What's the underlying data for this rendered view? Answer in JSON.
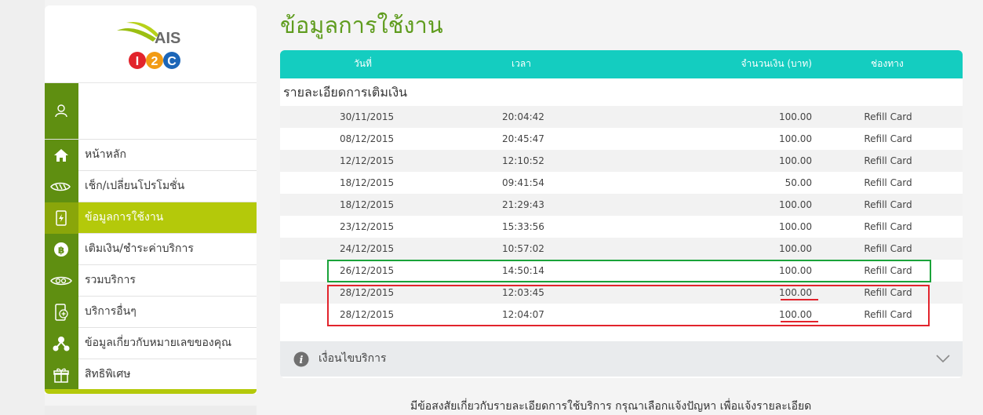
{
  "brand": {
    "logo_text": "AIS",
    "logo_sub": [
      "I",
      "2",
      "C"
    ],
    "colors": {
      "ais_green": "#9bbf12",
      "i_red": "#e2242c",
      "two_orange": "#f29b13",
      "c_blue": "#1c66b8"
    }
  },
  "sidebar": {
    "profile_icon": "user-icon",
    "items": [
      {
        "label": "หน้าหลัก",
        "icon": "home-icon",
        "active": false
      },
      {
        "label": "เช็ก/เปลี่ยนโปรโมชั่น",
        "icon": "promo-icon",
        "active": false
      },
      {
        "label": "ข้อมูลการใช้งาน",
        "icon": "usage-icon",
        "active": true
      },
      {
        "label": "เติมเงิน/ชำระค่าบริการ",
        "icon": "baht-icon",
        "active": false
      },
      {
        "label": "รวมบริการ",
        "icon": "services-icon",
        "active": false
      },
      {
        "label": "บริการอื่นๆ",
        "icon": "phone-plus-icon",
        "active": false
      },
      {
        "label": "ข้อมูลเกี่ยวกับหมายเลขของคุณ",
        "icon": "network-icon",
        "active": false
      },
      {
        "label": "สิทธิพิเศษ",
        "icon": "gift-icon",
        "active": false
      }
    ],
    "colors": {
      "icon_bg": "#5f8f11",
      "active_bg": "#b4c90a"
    }
  },
  "main": {
    "title": "ข้อมูลการใช้งาน",
    "table": {
      "headers": {
        "date": "วันที่",
        "time": "เวลา",
        "amount": "จำนวนเงิน (บาท)",
        "channel": "ช่องทาง"
      },
      "section_title": "รายละเอียดการเติมเงิน",
      "rows": [
        {
          "date": "30/11/2015",
          "time": "20:04:42",
          "amount": "100.00",
          "channel": "Refill Card"
        },
        {
          "date": "08/12/2015",
          "time": "20:45:47",
          "amount": "100.00",
          "channel": "Refill Card"
        },
        {
          "date": "12/12/2015",
          "time": "12:10:52",
          "amount": "100.00",
          "channel": "Refill Card"
        },
        {
          "date": "18/12/2015",
          "time": "09:41:54",
          "amount": "50.00",
          "channel": "Refill Card"
        },
        {
          "date": "18/12/2015",
          "time": "21:29:43",
          "amount": "100.00",
          "channel": "Refill Card"
        },
        {
          "date": "23/12/2015",
          "time": "15:33:56",
          "amount": "100.00",
          "channel": "Refill Card"
        },
        {
          "date": "24/12/2015",
          "time": "10:57:02",
          "amount": "100.00",
          "channel": "Refill Card"
        },
        {
          "date": "26/12/2015",
          "time": "14:50:14",
          "amount": "100.00",
          "channel": "Refill Card"
        },
        {
          "date": "28/12/2015",
          "time": "12:03:45",
          "amount": "100.00",
          "channel": "Refill Card"
        },
        {
          "date": "28/12/2015",
          "time": "12:04:07",
          "amount": "100.00",
          "channel": "Refill Card"
        }
      ],
      "header_color": "#14cdc0"
    },
    "accordion": {
      "label": "เงื่อนไขบริการ"
    },
    "annotations": {
      "green": "#1aa33a",
      "red": "#e2242c"
    }
  },
  "footer": {
    "text": "มีข้อสงสัยเกี่ยวกับรายละเอียดการใช้บริการ กรุณาเลือกแจ้งปัญหา เพื่อแจ้งรายละเอียด"
  }
}
